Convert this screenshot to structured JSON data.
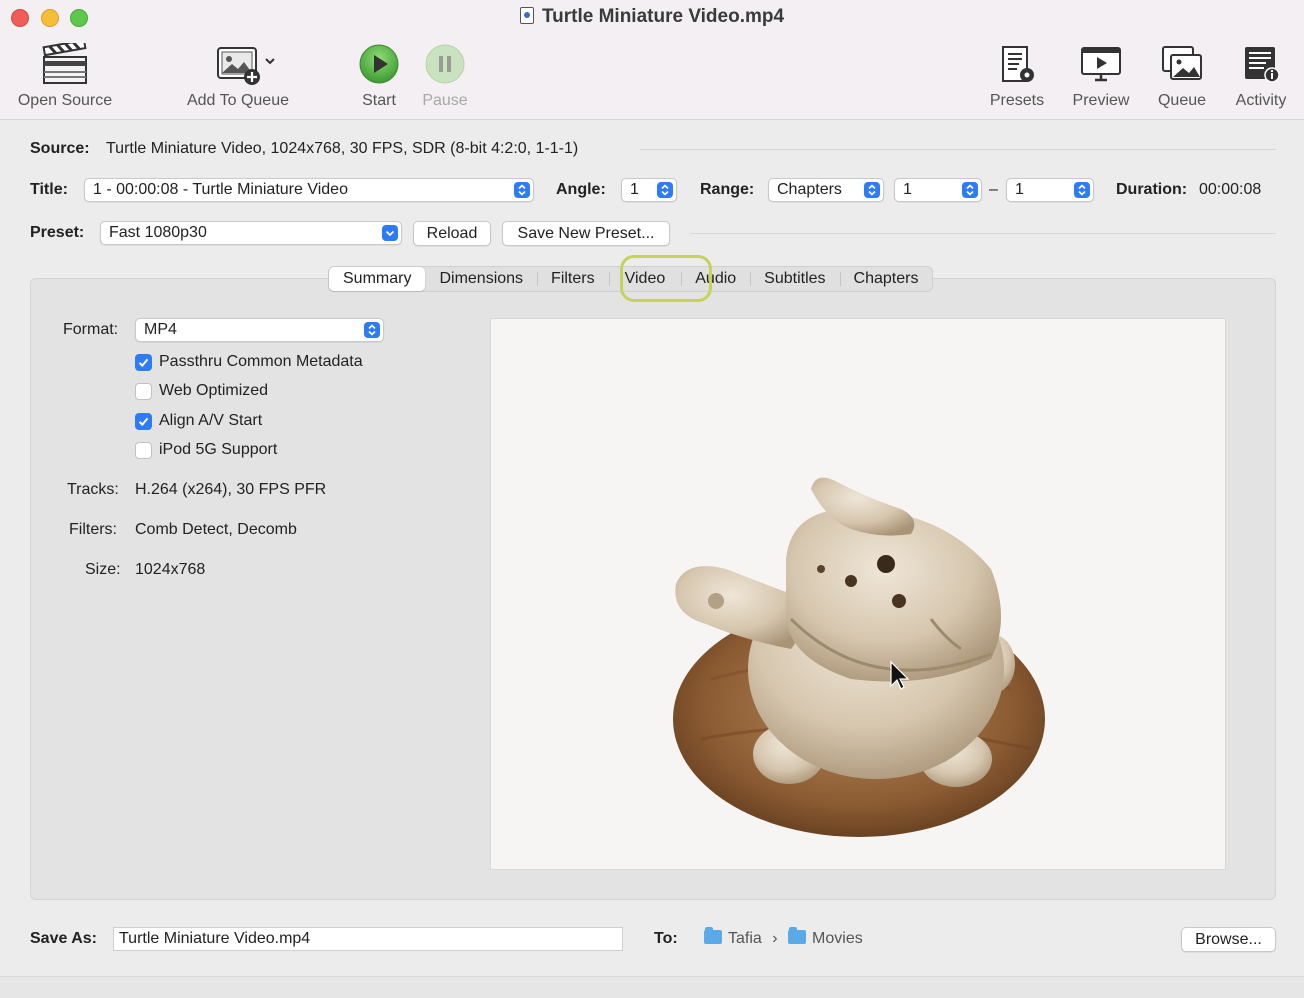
{
  "window": {
    "title": "Turtle Miniature Video.mp4"
  },
  "toolbar": {
    "open_source": "Open Source",
    "add_to_queue": "Add To Queue",
    "start": "Start",
    "pause": "Pause",
    "presets": "Presets",
    "preview": "Preview",
    "queue": "Queue",
    "activity": "Activity"
  },
  "source": {
    "label": "Source:",
    "value": "Turtle Miniature Video, 1024x768, 30 FPS, SDR (8-bit 4:2:0, 1-1-1)"
  },
  "title_row": {
    "title_label": "Title:",
    "title_value": "1 - 00:00:08 - Turtle Miniature Video",
    "angle_label": "Angle:",
    "angle_value": "1",
    "range_label": "Range:",
    "range_type": "Chapters",
    "range_start": "1",
    "range_dash": "–",
    "range_end": "1",
    "duration_label": "Duration:",
    "duration_value": "00:00:08"
  },
  "preset_row": {
    "label": "Preset:",
    "value": "Fast 1080p30",
    "reload": "Reload",
    "save_new": "Save New Preset..."
  },
  "tabs": [
    {
      "label": "Summary",
      "active": true
    },
    {
      "label": "Dimensions",
      "active": false
    },
    {
      "label": "Filters",
      "active": false
    },
    {
      "label": "Video",
      "active": false,
      "highlighted": true
    },
    {
      "label": "Audio",
      "active": false
    },
    {
      "label": "Subtitles",
      "active": false
    },
    {
      "label": "Chapters",
      "active": false
    }
  ],
  "summary": {
    "format_label": "Format:",
    "format_value": "MP4",
    "options": [
      {
        "label": "Passthru Common Metadata",
        "checked": true
      },
      {
        "label": "Web Optimized",
        "checked": false
      },
      {
        "label": "Align A/V Start",
        "checked": true
      },
      {
        "label": "iPod 5G Support",
        "checked": false
      }
    ],
    "tracks_label": "Tracks:",
    "tracks_value": "H.264 (x264), 30 FPS PFR",
    "filters_label": "Filters:",
    "filters_value": "Comb Detect, Decomb",
    "size_label": "Size:",
    "size_value": "1024x768"
  },
  "save": {
    "save_as_label": "Save As:",
    "file_name": "Turtle Miniature Video.mp4",
    "to_label": "To:",
    "path": [
      "Tafia",
      "Movies"
    ],
    "path_sep": "›",
    "browse": "Browse..."
  },
  "colors": {
    "accent": "#2f7bf5",
    "highlight_ring": "#c7d25a",
    "start_green": "#5bb84a"
  }
}
